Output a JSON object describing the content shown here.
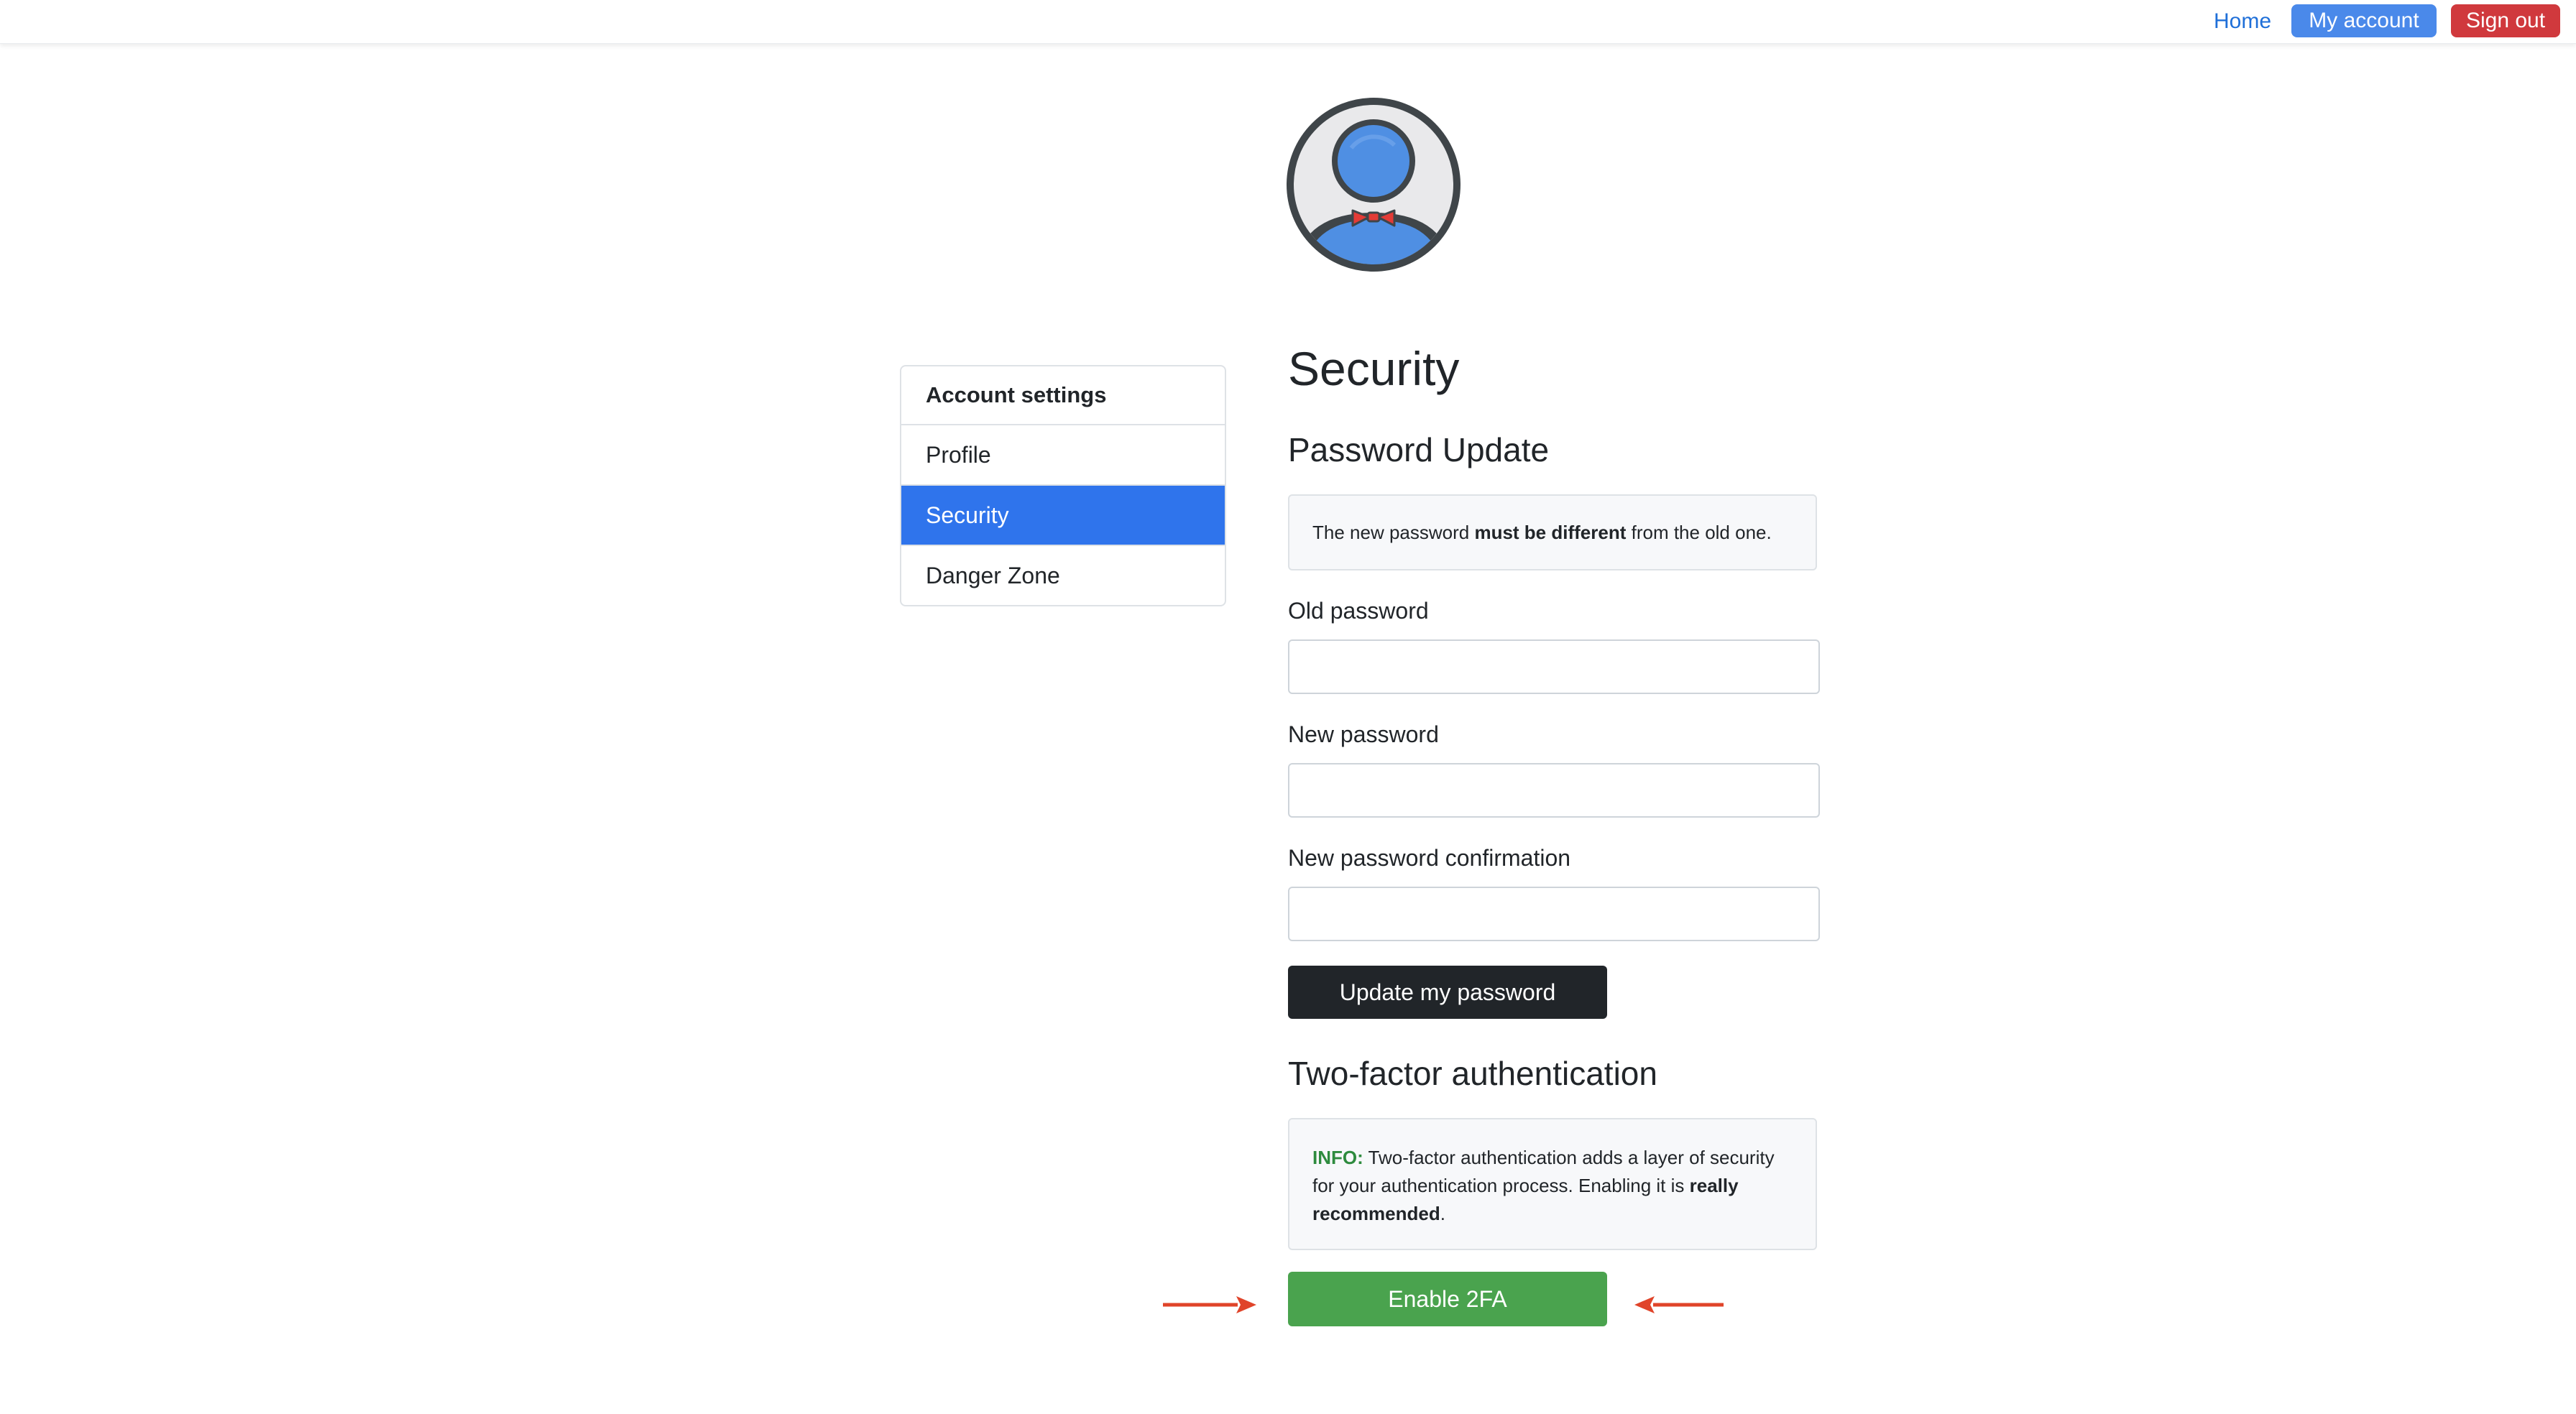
{
  "navbar": {
    "home_label": "Home",
    "account_label": "My account",
    "signout_label": "Sign out"
  },
  "colors": {
    "primary": "#2f74ec",
    "account_button": "#4a89ea",
    "danger": "#d0393d",
    "success": "#4aa34e",
    "dark": "#212529",
    "info_text": "#2e8b3e",
    "annotation_arrow": "#e0442a"
  },
  "avatar": {
    "icon": "user-avatar-bowtie-icon"
  },
  "sidebar": {
    "header": "Account settings",
    "items": [
      {
        "label": "Profile",
        "active": false
      },
      {
        "label": "Security",
        "active": true
      },
      {
        "label": "Danger Zone",
        "active": false
      }
    ]
  },
  "main": {
    "title": "Security",
    "password_update": {
      "title": "Password Update",
      "notice_prefix": "The new password ",
      "notice_bold": "must be different",
      "notice_suffix": " from the old one.",
      "old_password_label": "Old password",
      "old_password_value": "",
      "new_password_label": "New password",
      "new_password_value": "",
      "confirm_label": "New password confirmation",
      "confirm_value": "",
      "submit_label": "Update my password"
    },
    "two_factor": {
      "title": "Two-factor authentication",
      "info_label": "INFO:",
      "info_text": " Two-factor authentication adds a layer of security for your authentication process. Enabling it is ",
      "info_bold": "really recommended",
      "info_end": ".",
      "enable_label": "Enable 2FA"
    }
  },
  "annotations": {
    "arrow_icon": "red-arrow-icon"
  }
}
